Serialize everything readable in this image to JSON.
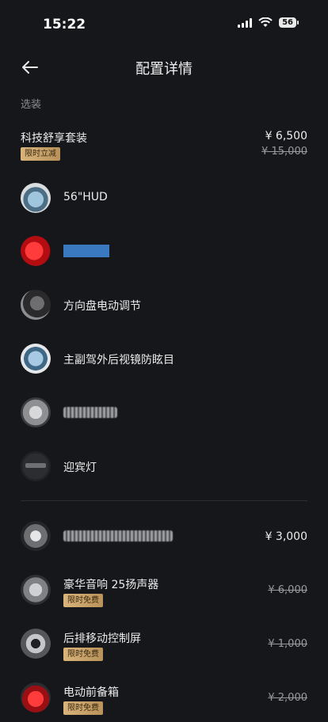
{
  "status": {
    "time": "15:22",
    "battery": "56"
  },
  "nav": {
    "title": "配置详情"
  },
  "section": {
    "label": "选装"
  },
  "package": {
    "name": "科技舒享套装",
    "tag": "限时立减",
    "price": "¥ 6,500",
    "old_price": "¥ 15,000"
  },
  "package_items": [
    {
      "label": "56\"HUD"
    },
    {
      "label": ""
    },
    {
      "label": "方向盘电动调节"
    },
    {
      "label": "主副驾外后视镜防眩目"
    },
    {
      "label": ""
    },
    {
      "label": "迎宾灯"
    }
  ],
  "options": [
    {
      "label": "",
      "price": "¥ 3,000"
    },
    {
      "label": "豪华音响 25扬声器",
      "tag": "限时免费",
      "old_price": "¥ 6,000"
    },
    {
      "label": "后排移动控制屏",
      "tag": "限时免费",
      "old_price": "¥ 1,000"
    },
    {
      "label": "电动前备箱",
      "tag": "限时免费",
      "old_price": "¥ 2,000"
    }
  ]
}
